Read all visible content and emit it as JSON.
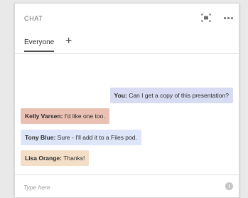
{
  "header": {
    "title": "CHAT",
    "icons": [
      "camera-icon",
      "more-icon"
    ]
  },
  "tabs": {
    "active": "Everyone",
    "add": "+"
  },
  "messages": [
    {
      "sender": "You:",
      "text": "Can I get a copy of this presentation?",
      "color": "#d7dcf3"
    },
    {
      "sender": "Kelly Varsen:",
      "text": "I'd like one too.",
      "color": "#e9c0b2"
    },
    {
      "sender": "Tony Blue:",
      "text": "Sure - I'll add it to a Files pod.",
      "color": "#dce6f8"
    },
    {
      "sender": "Lisa Orange:",
      "text": "Thanks!",
      "color": "#f3dfc8"
    }
  ],
  "composer": {
    "placeholder": "Type here",
    "info_icon": "info-icon"
  }
}
